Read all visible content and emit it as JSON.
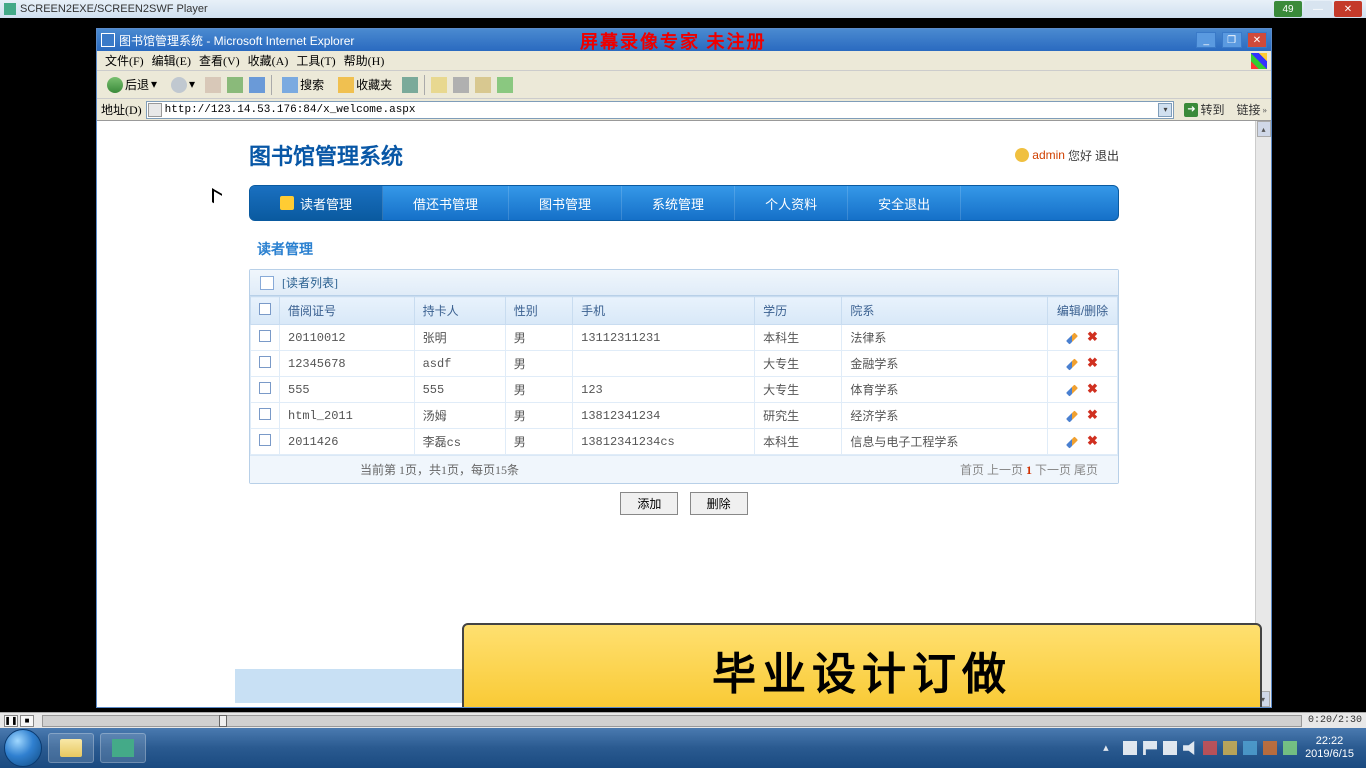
{
  "player": {
    "title": "SCREEN2EXE/SCREEN2SWF Player",
    "badge": "49",
    "time": "0:20/2:30"
  },
  "ie": {
    "title": "图书馆管理系统 - Microsoft Internet Explorer",
    "menu": {
      "file": "文件(F)",
      "edit": "编辑(E)",
      "view": "查看(V)",
      "fav": "收藏(A)",
      "tools": "工具(T)",
      "help": "帮助(H)"
    },
    "toolbar": {
      "back": "后退",
      "search": "搜索",
      "favorites": "收藏夹"
    },
    "addr_label": "地址(D)",
    "url": "http://123.14.53.176:84/x_welcome.aspx",
    "go": "转到",
    "links": "链接"
  },
  "watermark": "屏幕录像专家  未注册",
  "app": {
    "logo": "图书馆管理系统",
    "user_name": "admin",
    "greet": "您好",
    "logout": "退出",
    "nav": [
      "读者管理",
      "借还书管理",
      "图书管理",
      "系统管理",
      "个人资料",
      "安全退出"
    ],
    "section": "读者管理",
    "panel_title": "[读者列表]",
    "columns": {
      "c1": "借阅证号",
      "c2": "持卡人",
      "c3": "性别",
      "c4": "手机",
      "c5": "学历",
      "c6": "院系",
      "c7": "编辑/删除"
    },
    "rows": [
      {
        "id": "20110012",
        "name": "张明",
        "sex": "男",
        "phone": "13112311231",
        "edu": "本科生",
        "dept": "法律系"
      },
      {
        "id": "12345678",
        "name": "asdf",
        "sex": "男",
        "phone": "",
        "edu": "大专生",
        "dept": "金融学系"
      },
      {
        "id": "555",
        "name": "555",
        "sex": "男",
        "phone": "123",
        "edu": "大专生",
        "dept": "体育学系"
      },
      {
        "id": "html_2011",
        "name": "汤姆",
        "sex": "男",
        "phone": "13812341234",
        "edu": "研究生",
        "dept": "经济学系"
      },
      {
        "id": "2011426",
        "name": "李磊cs",
        "sex": "男",
        "phone": "13812341234cs",
        "edu": "本科生",
        "dept": "信息与电子工程学系"
      }
    ],
    "page_info": "当前第 1页，共1页，每页15条",
    "pager": {
      "first": "首页",
      "prev": "上一页",
      "cur": "1",
      "next": "下一页",
      "last": "尾页"
    },
    "btn_add": "添加",
    "btn_del": "删除"
  },
  "ad": "毕业设计订做",
  "taskbar": {
    "time": "22:22",
    "date": "2019/6/15"
  }
}
